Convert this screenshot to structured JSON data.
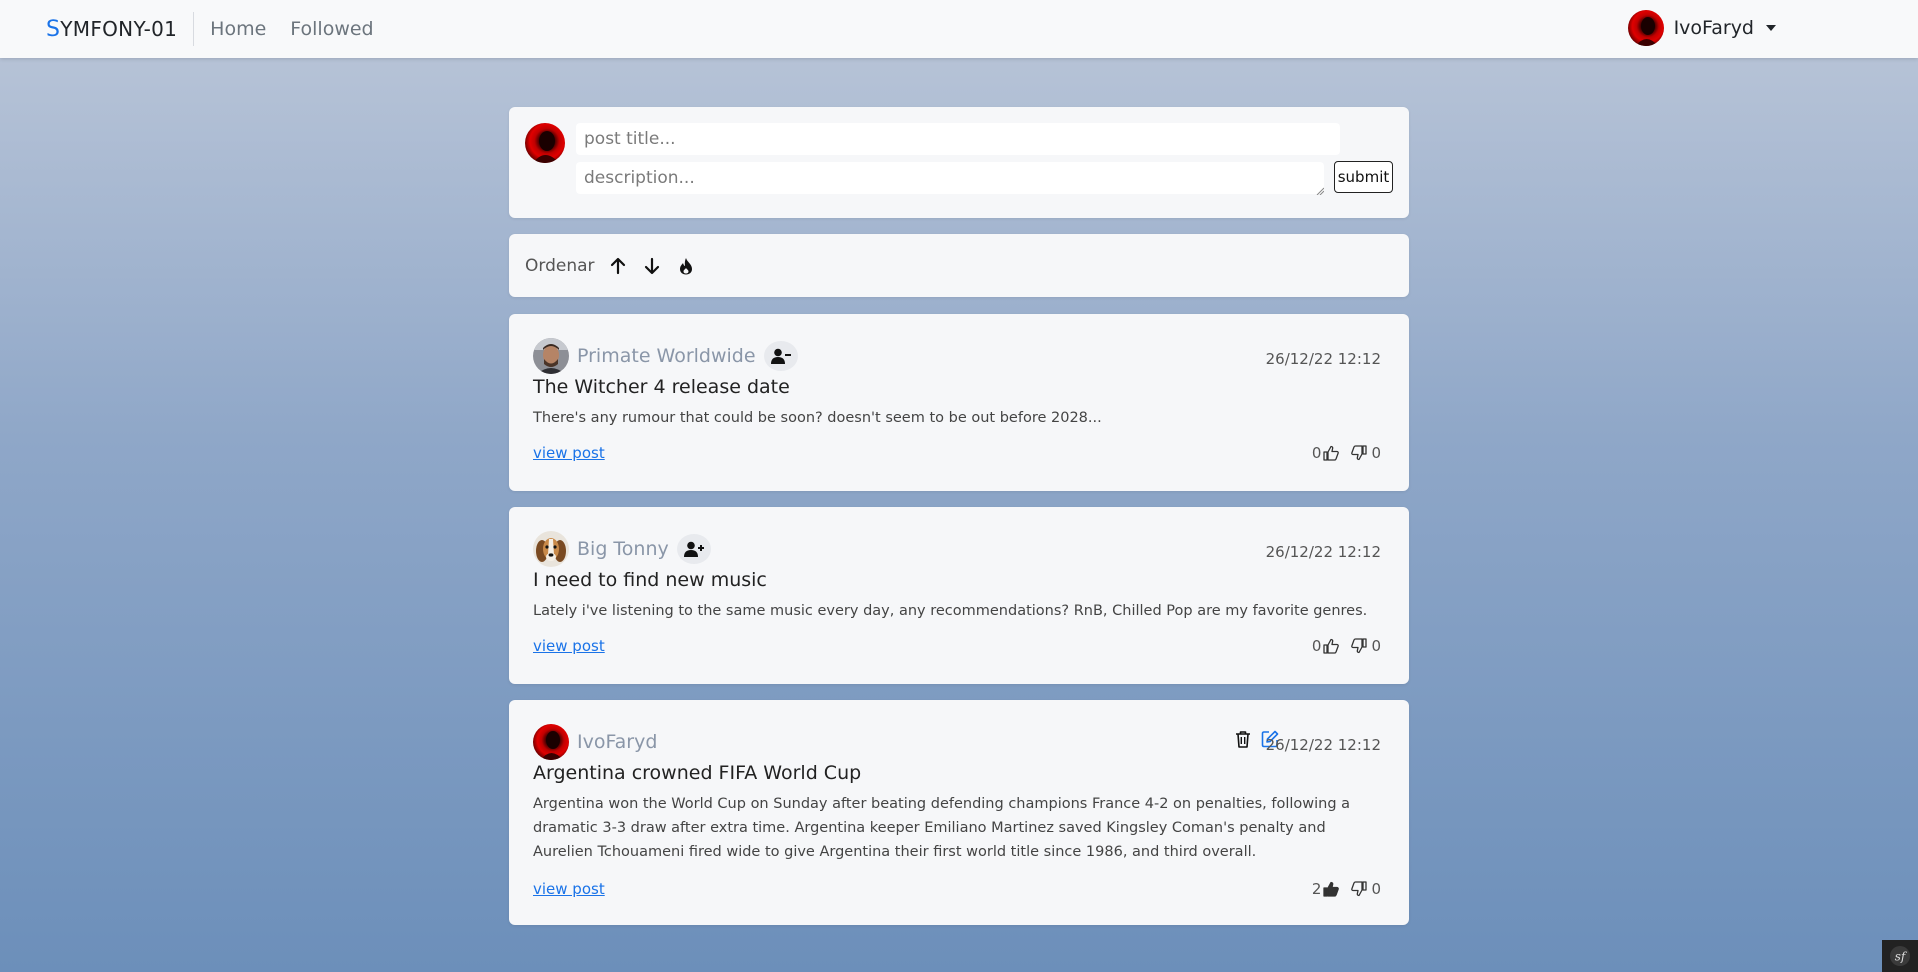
{
  "navbar": {
    "brand_first": "S",
    "brand_rest": "YMFONY-01",
    "links": [
      "Home",
      "Followed"
    ],
    "user": "IvoFaryd"
  },
  "composer": {
    "title_placeholder": "post title...",
    "desc_placeholder": "description...",
    "submit_label": "submit"
  },
  "sort": {
    "label": "Ordenar",
    "icons": [
      "arrow-up-icon",
      "arrow-down-icon",
      "flame-icon"
    ]
  },
  "posts": [
    {
      "author": "Primate Worldwide",
      "follow_icon": "user-minus-icon",
      "date": "26/12/22 12:12",
      "title": "The Witcher 4 release date",
      "description": "There's any rumour that could be soon? doesn't seem to be out before 2028...",
      "view_label": "view post",
      "likes": "0",
      "dislikes": "0"
    },
    {
      "author": "Big Tonny",
      "follow_icon": "user-plus-icon",
      "date": "26/12/22 12:12",
      "title": "I need to find new music",
      "description": "Lately i've listening to the same music every day, any recommendations? RnB, Chilled Pop are my favorite genres.",
      "view_label": "view post",
      "likes": "0",
      "dislikes": "0"
    },
    {
      "author": "IvoFaryd",
      "date": "26/12/22 12:12",
      "title": "Argentina crowned FIFA World Cup",
      "description": "Argentina won the World Cup on Sunday after beating defending champions France 4-2 on penalties, following a dramatic 3-3 draw after extra time. Argentina keeper Emiliano Martinez saved Kingsley Coman's penalty and Aurelien Tchouameni fired wide to give Argentina their first world title since 1986, and third overall.",
      "view_label": "view post",
      "likes": "2",
      "dislikes": "0"
    }
  ],
  "colors": {
    "accent": "#1a73e8",
    "author": "#8a96a8"
  }
}
